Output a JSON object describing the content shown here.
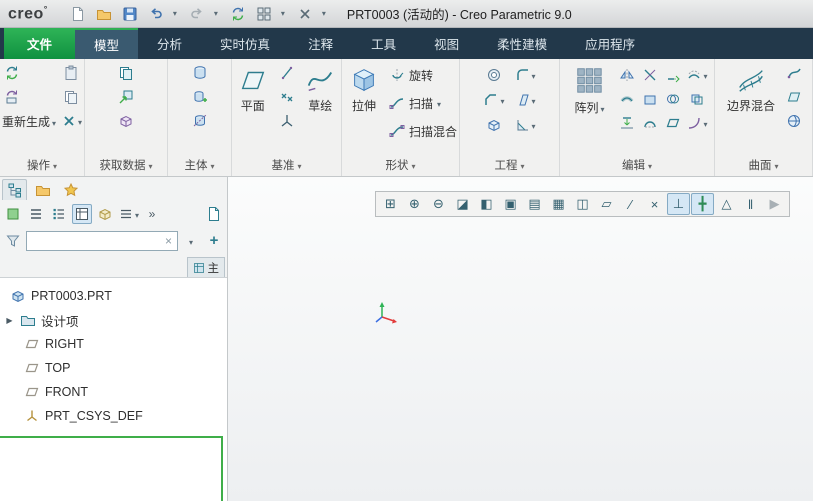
{
  "titlebar": {
    "logo": "creo",
    "logo_mark": "°",
    "title": "PRT0003 (活动的) - Creo Parametric 9.0",
    "icons": [
      "new-file-icon",
      "open-icon",
      "save-icon",
      "undo-icon",
      "undo-dropdown",
      "redo-icon",
      "redo-dropdown",
      "regenerate-quick-icon",
      "windows-icon",
      "windows-dropdown",
      "close-window-icon",
      "customize-toolbar-dropdown"
    ]
  },
  "tabs": [
    {
      "id": "file",
      "label": "文件"
    },
    {
      "id": "model",
      "label": "模型",
      "active": true
    },
    {
      "id": "analysis",
      "label": "分析"
    },
    {
      "id": "live-simulation",
      "label": "实时仿真"
    },
    {
      "id": "annotate",
      "label": "注释"
    },
    {
      "id": "tools",
      "label": "工具"
    },
    {
      "id": "view",
      "label": "视图"
    },
    {
      "id": "flexible-modeling",
      "label": "柔性建模"
    },
    {
      "id": "applications",
      "label": "应用程序"
    }
  ],
  "ribbon": {
    "group_labels": {
      "operations": "操作",
      "get_data": "获取数据",
      "body": "主体",
      "datum": "基准",
      "shapes": "形状",
      "engineering": "工程",
      "editing": "编辑",
      "surfaces": "曲面"
    },
    "buttons": {
      "regenerate": "重新生成",
      "plane": "平面",
      "sketch": "草绘",
      "extrude": "拉伸",
      "revolve": "旋转",
      "sweep": "扫描",
      "swept_blend": "扫描混合",
      "pattern": "阵列",
      "boundary_blend": "边界混合"
    },
    "icon_names": [
      "regenerate-icon",
      "regenerate-manager-icon",
      "paste-icon",
      "copy-icon",
      "delete-icon",
      "user-defined-feature-icon",
      "import-icon",
      "shrinkwrap-icon",
      "new-body-icon",
      "body-operations-icon",
      "body-split-icon",
      "datum-plane-icon",
      "datum-axis-icon",
      "datum-point-icon",
      "datum-csys-icon",
      "sketch-icon",
      "extrude-icon",
      "revolve-icon",
      "sweep-icon",
      "swept-blend-icon",
      "hole-icon",
      "round-icon",
      "chamfer-icon",
      "draft-icon",
      "shell-icon",
      "rib-icon",
      "pattern-icon",
      "mirror-icon",
      "trim-icon",
      "extend-icon",
      "offset-icon",
      "thicken-icon",
      "solidify-icon",
      "intersect-icon",
      "merge-icon",
      "project-icon",
      "wrap-icon",
      "flatten-icon",
      "bend-icon",
      "boundary-blend-icon",
      "style-icon",
      "fill-icon",
      "freestyle-icon"
    ]
  },
  "navigator": {
    "filter_value": "",
    "side_tab_label": "主",
    "icon_names": [
      "model-tree-tab",
      "folder-browser-tab",
      "favorites-tab",
      "tree-part-icon",
      "tree-list-icon",
      "tree-columns-icon",
      "tree-expand-icon",
      "tree-show-icon",
      "tree-settings-icon",
      "toolbar-overflow-button",
      "detach-panel-icon",
      "filter-funnel-icon",
      "clear-filter-icon",
      "filter-dropdown",
      "add-filter-button"
    ]
  },
  "tree": {
    "items": [
      {
        "label": "PRT0003.PRT",
        "icon": "part-icon"
      },
      {
        "label": "设计项",
        "icon": "design-items-icon",
        "expandable": true
      },
      {
        "label": "RIGHT",
        "icon": "datum-plane-icon"
      },
      {
        "label": "TOP",
        "icon": "datum-plane-icon"
      },
      {
        "label": "FRONT",
        "icon": "datum-plane-icon"
      },
      {
        "label": "PRT_CSYS_DEF",
        "icon": "csys-icon"
      }
    ]
  },
  "graphics_toolbar": {
    "buttons": [
      {
        "name": "zoom-region-button",
        "glyph": "⊞"
      },
      {
        "name": "zoom-in-button",
        "glyph": "⊕"
      },
      {
        "name": "zoom-out-button",
        "glyph": "⊖"
      },
      {
        "name": "repaint-button",
        "glyph": "◪"
      },
      {
        "name": "enhanced-realism-button",
        "glyph": "◧"
      },
      {
        "name": "refit-button",
        "glyph": "▣"
      },
      {
        "name": "saved-orientations-button",
        "glyph": "▤"
      },
      {
        "name": "capture-button",
        "glyph": "▦"
      },
      {
        "name": "display-style-button",
        "glyph": "◫"
      },
      {
        "name": "datum-plane-display-button",
        "glyph": "▱"
      },
      {
        "name": "datum-axis-display-button",
        "glyph": "∕"
      },
      {
        "name": "datum-point-display-button",
        "glyph": "×"
      },
      {
        "name": "csys-display-button",
        "glyph": "⊥",
        "pressed": true
      },
      {
        "name": "spin-center-button",
        "glyph": "╋",
        "pressed": true,
        "color": "#2e8b57"
      },
      {
        "name": "annotation-display-button",
        "glyph": "△"
      },
      {
        "name": "pause-button",
        "glyph": "‖"
      },
      {
        "name": "play-button",
        "glyph": "▶",
        "color": "#a8b0b5"
      }
    ]
  },
  "colors": {
    "accent_green": "#2fae53",
    "tab_bar": "#22384a",
    "ribbon_bg": "#f1f1f0",
    "pressed_bg": "#d5e7f5",
    "insert_line": "#3fae49",
    "csys_x": "#e23b3b",
    "csys_y": "#2fb457",
    "csys_z": "#3b6fe2"
  }
}
